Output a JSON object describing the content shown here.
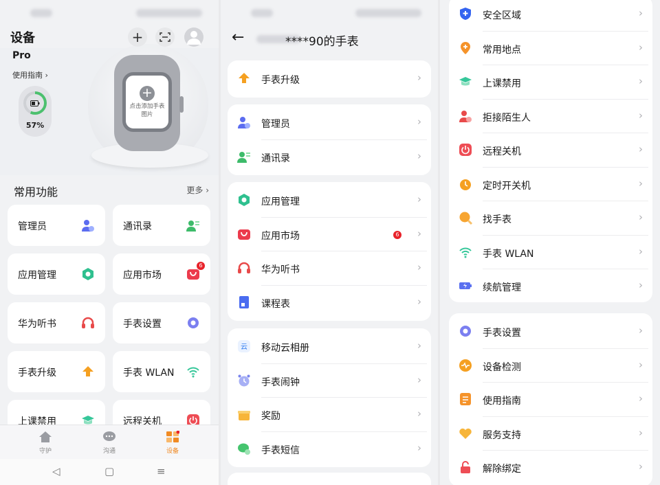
{
  "panel1": {
    "title": "设备",
    "model": "Pro",
    "guide": "使用指南 ›",
    "battery": "57%",
    "battery_level": 0.57,
    "watch_add_text": "点击添加手表图片",
    "section_title": "常用功能",
    "more": "更多 ›",
    "tiles": [
      {
        "label": "管理员",
        "icon": "admin-icon"
      },
      {
        "label": "通讯录",
        "icon": "contacts-icon"
      },
      {
        "label": "应用管理",
        "icon": "app-manage-icon"
      },
      {
        "label": "应用市场",
        "icon": "app-market-icon",
        "badge": "6"
      },
      {
        "label": "华为听书",
        "icon": "headphones-icon"
      },
      {
        "label": "手表设置",
        "icon": "settings-icon"
      },
      {
        "label": "手表升级",
        "icon": "upgrade-icon"
      },
      {
        "label": "手表 WLAN",
        "icon": "wlan-icon"
      },
      {
        "label": "上课禁用",
        "icon": "class-mode-icon"
      },
      {
        "label": "远程关机",
        "icon": "power-icon"
      }
    ],
    "tabs": [
      {
        "label": "守护",
        "icon": "home-icon"
      },
      {
        "label": "沟通",
        "icon": "chat-icon"
      },
      {
        "label": "设备",
        "icon": "device-icon",
        "active": true
      }
    ]
  },
  "panel2": {
    "title": "****90的手表",
    "groups": [
      [
        {
          "label": "手表升级",
          "icon": "upgrade-icon"
        }
      ],
      [
        {
          "label": "管理员",
          "icon": "admin-icon"
        },
        {
          "label": "通讯录",
          "icon": "contacts-icon"
        }
      ],
      [
        {
          "label": "应用管理",
          "icon": "app-manage-icon"
        },
        {
          "label": "应用市场",
          "icon": "app-market-icon",
          "badge": "6"
        },
        {
          "label": "华为听书",
          "icon": "headphones-icon"
        },
        {
          "label": "课程表",
          "icon": "schedule-icon"
        }
      ],
      [
        {
          "label": "移动云相册",
          "icon": "cloud-album-icon"
        },
        {
          "label": "手表闹钟",
          "icon": "alarm-icon"
        },
        {
          "label": "奖励",
          "icon": "reward-icon"
        },
        {
          "label": "手表短信",
          "icon": "sms-icon"
        }
      ]
    ]
  },
  "panel3": {
    "groups": [
      [
        {
          "label": "安全区域",
          "icon": "safe-zone-icon"
        },
        {
          "label": "常用地点",
          "icon": "location-icon"
        },
        {
          "label": "上课禁用",
          "icon": "class-mode-icon"
        },
        {
          "label": "拒接陌生人",
          "icon": "block-stranger-icon"
        },
        {
          "label": "远程关机",
          "icon": "power-icon"
        },
        {
          "label": "定时开关机",
          "icon": "timer-power-icon"
        },
        {
          "label": "找手表",
          "icon": "find-watch-icon"
        },
        {
          "label": "手表 WLAN",
          "icon": "wlan-icon"
        },
        {
          "label": "续航管理",
          "icon": "battery-manage-icon"
        }
      ],
      [
        {
          "label": "手表设置",
          "icon": "settings-icon"
        },
        {
          "label": "设备检测",
          "icon": "device-check-icon"
        },
        {
          "label": "使用指南",
          "icon": "guide-icon"
        },
        {
          "label": "服务支持",
          "icon": "support-icon"
        },
        {
          "label": "解除绑定",
          "icon": "unbind-icon"
        }
      ]
    ]
  },
  "colors": {
    "accent": "#f08a24",
    "badge": "#e8222a",
    "battery": "#4cc06e"
  }
}
